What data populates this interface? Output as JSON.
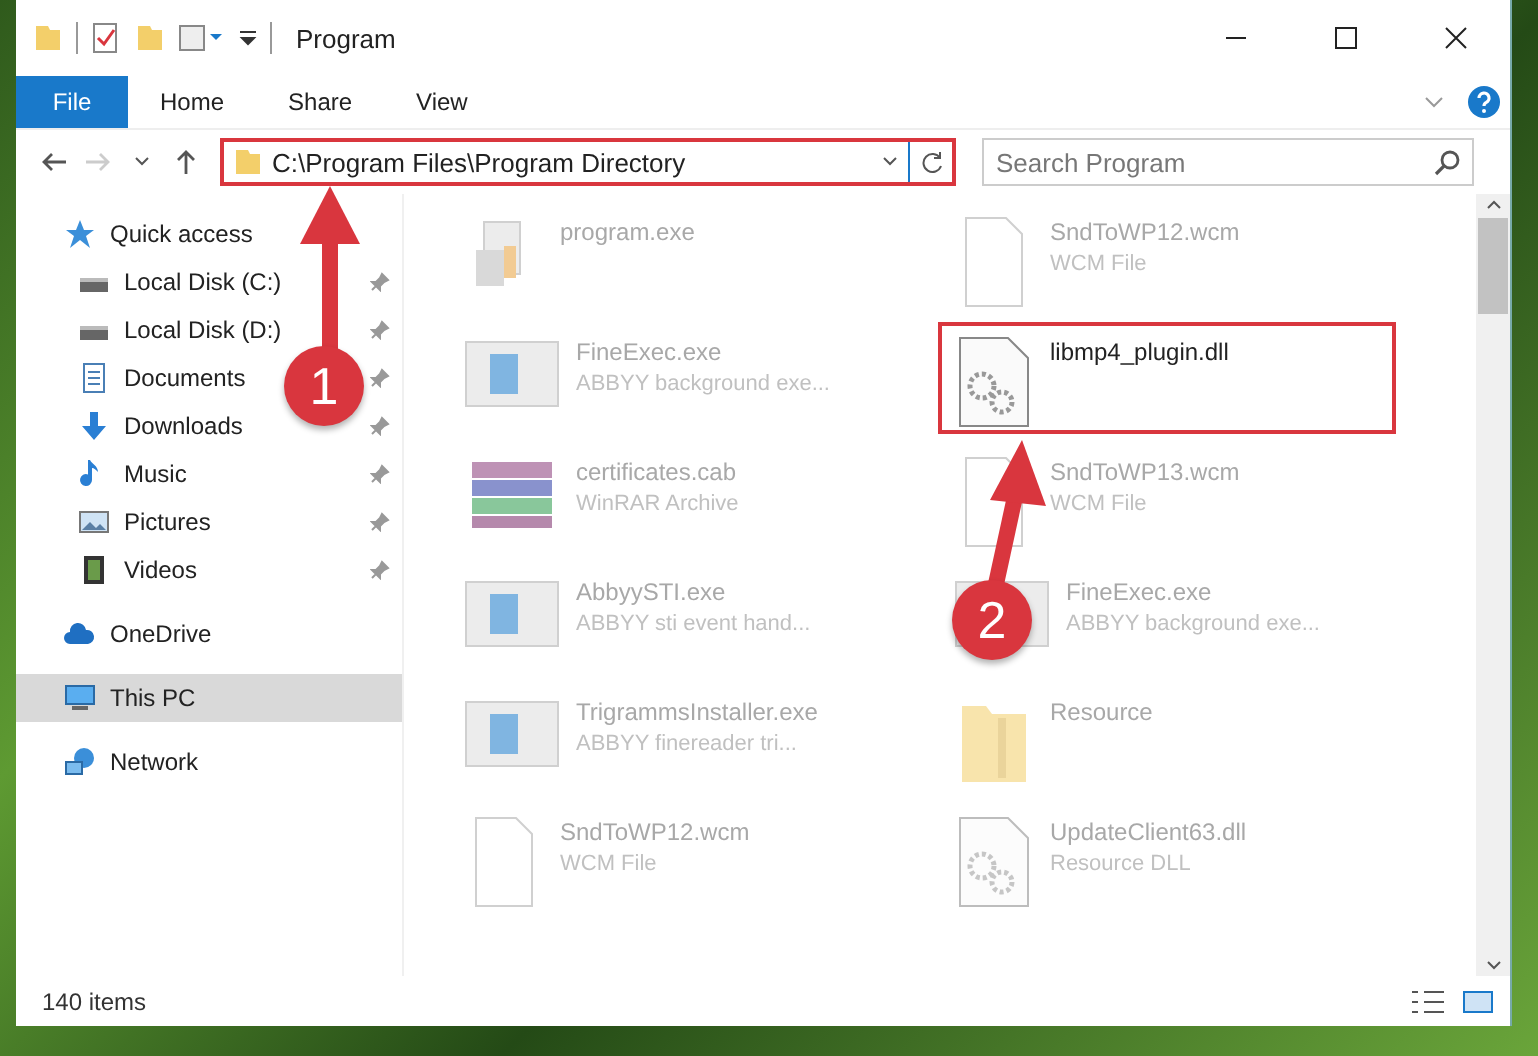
{
  "window": {
    "title": "Program"
  },
  "ribbon_tabs": [
    {
      "label": "File",
      "selected": true
    },
    {
      "label": "Home",
      "selected": false
    },
    {
      "label": "Share",
      "selected": false
    },
    {
      "label": "View",
      "selected": false
    }
  ],
  "address": {
    "path": "C:\\Program Files\\Program Directory",
    "highlighted": true
  },
  "search": {
    "placeholder": "Search Program"
  },
  "sidebar": {
    "items": [
      {
        "label": "Quick access",
        "kind": "star",
        "selected": false,
        "children": [
          {
            "label": "Local Disk (C:)",
            "kind": "drive",
            "pinned": true,
            "selected": false
          },
          {
            "label": "Local Disk (D:)",
            "kind": "drive",
            "pinned": true,
            "selected": false
          },
          {
            "label": "Documents",
            "kind": "document",
            "pinned": true,
            "selected": false
          },
          {
            "label": "Downloads",
            "kind": "download",
            "pinned": true,
            "selected": false
          },
          {
            "label": "Music",
            "kind": "music",
            "pinned": true,
            "selected": false
          },
          {
            "label": "Pictures",
            "kind": "picture",
            "pinned": true,
            "selected": false
          },
          {
            "label": "Videos",
            "kind": "video",
            "pinned": true,
            "selected": false
          }
        ]
      },
      {
        "label": "OneDrive",
        "kind": "cloud",
        "selected": false
      },
      {
        "label": "This PC",
        "kind": "computer",
        "selected": true
      },
      {
        "label": "Network",
        "kind": "network",
        "selected": false
      }
    ]
  },
  "files": [
    {
      "name": "program.exe",
      "kind": "installer",
      "blurred": true,
      "highlighted": false
    },
    {
      "name": "SndToWP12.wcm",
      "description": "WCM File",
      "kind": "blank",
      "blurred": true,
      "highlighted": false
    },
    {
      "name": "FineExec.exe",
      "description": "ABBYY background exe...",
      "kind": "app",
      "blurred": true,
      "highlighted": false
    },
    {
      "name": "libmp4_plugin.dll",
      "kind": "dll",
      "blurred": false,
      "highlighted": true
    },
    {
      "name": "certificates.cab",
      "description": "WinRAR Archive",
      "kind": "archive",
      "blurred": true,
      "highlighted": false
    },
    {
      "name": "SndToWP13.wcm",
      "description": "WCM File",
      "kind": "blank",
      "blurred": true,
      "highlighted": false
    },
    {
      "name": "AbbyySTI.exe",
      "description": "ABBYY sti event hand...",
      "kind": "app",
      "blurred": true,
      "highlighted": false
    },
    {
      "name": "FineExec.exe",
      "description": "ABBYY background exe...",
      "kind": "app",
      "blurred": true,
      "highlighted": false
    },
    {
      "name": "TrigrammsInstaller.exe",
      "description": "ABBYY finereader tri...",
      "kind": "app",
      "blurred": true,
      "highlighted": false
    },
    {
      "name": "Resource",
      "kind": "folder",
      "blurred": true,
      "highlighted": false
    },
    {
      "name": "SndToWP12.wcm",
      "description": "WCM File",
      "kind": "blank",
      "blurred": true,
      "highlighted": false
    },
    {
      "name": "UpdateClient63.dll",
      "description": "Resource DLL",
      "kind": "dll",
      "blurred": true,
      "highlighted": false
    }
  ],
  "status_bar": {
    "count": "140 items"
  },
  "annotations": [
    {
      "number": "1"
    },
    {
      "number": "2"
    }
  ]
}
